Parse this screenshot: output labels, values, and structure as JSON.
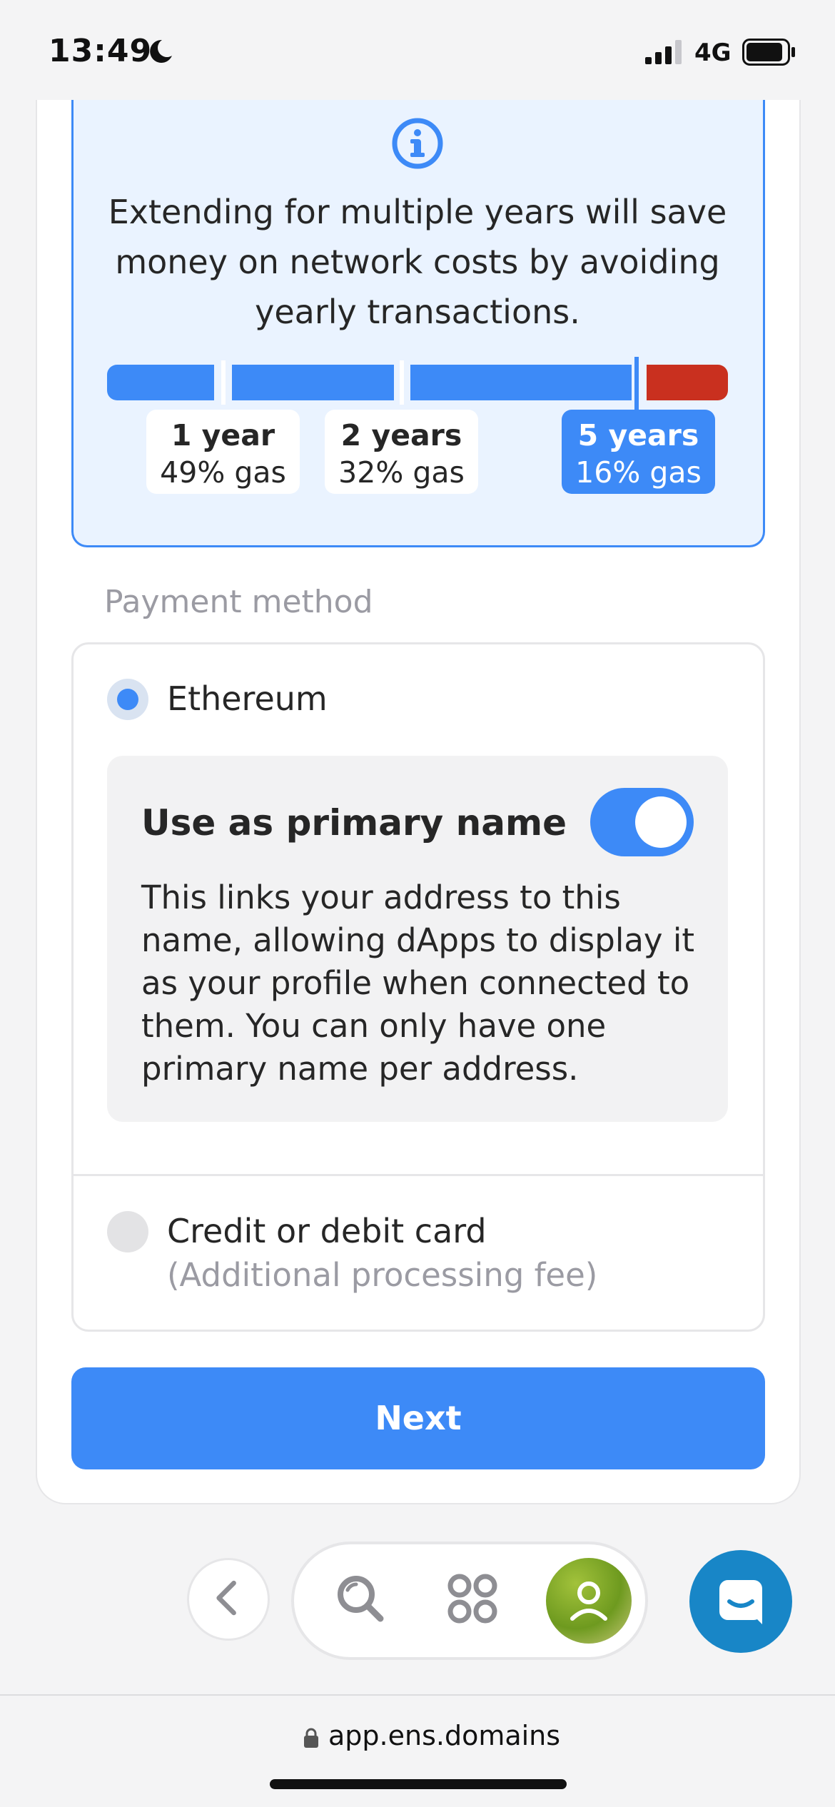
{
  "status_bar": {
    "time": "13:49",
    "network": "4G",
    "icons": [
      "moon-icon",
      "signal-icon",
      "battery-icon"
    ]
  },
  "info_box": {
    "icon": "info-icon",
    "text": "Extending for multiple years will save money on network costs by avoiding yearly transactions.",
    "options": [
      {
        "label": "1 year",
        "gas": "49% gas",
        "selected": false
      },
      {
        "label": "2 years",
        "gas": "32% gas",
        "selected": false
      },
      {
        "label": "5 years",
        "gas": "16% gas",
        "selected": true
      }
    ],
    "colors": {
      "bar": "#3d8af7",
      "bar_end": "#c9301f",
      "background": "#eaf3ff"
    }
  },
  "payment": {
    "label": "Payment method",
    "options": [
      {
        "label": "Ethereum",
        "selected": true
      },
      {
        "label": "Credit or debit card",
        "sublabel": "(Additional processing fee)",
        "selected": false
      }
    ],
    "primary_name": {
      "title": "Use as primary name",
      "enabled": true,
      "description": "This links your address to this name, allowing dApps to display it as your profile when connected to them. You can only have one primary name per address."
    }
  },
  "next_button": {
    "label": "Next"
  },
  "bottom_nav": {
    "items": [
      "back-icon",
      "search-icon",
      "apps-icon",
      "profile-icon"
    ],
    "chat": "chat-icon"
  },
  "browser": {
    "url": "app.ens.domains"
  },
  "colors": {
    "accent": "#3d8af7",
    "chat": "#1886c7"
  }
}
